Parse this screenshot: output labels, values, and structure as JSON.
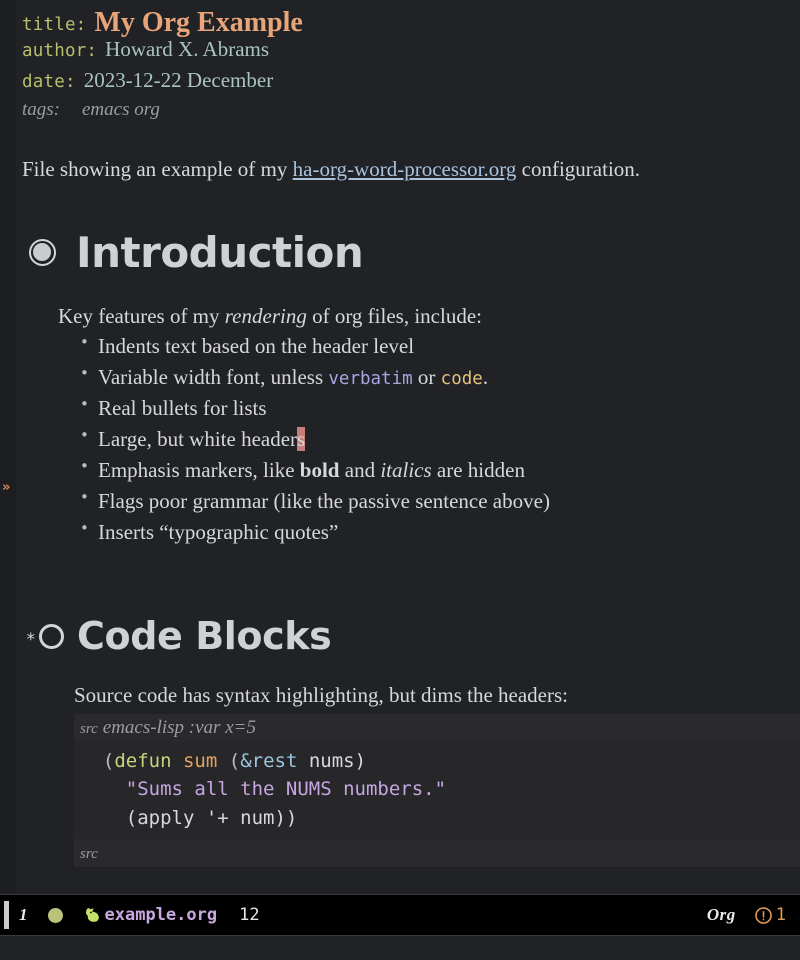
{
  "buffer": {
    "keywords": [
      {
        "key": "title:",
        "value": "My Org Example"
      },
      {
        "key": "author:",
        "value": "Howard X. Abrams"
      },
      {
        "key": "date:",
        "value": "2023-12-22 December"
      }
    ],
    "tags": {
      "key": "tags:",
      "value": "emacs org"
    },
    "intro_paragraph": {
      "before": "File showing an example of my ",
      "link": "ha-org-word-processor.org",
      "after": " configuration."
    },
    "fringe_marker": "»",
    "sections": [
      {
        "bullet_icon": "ring-filled-icon",
        "heading": "Introduction",
        "lead": {
          "before": "Key features of my ",
          "emphasis": "rendering",
          "after": " of org files, include:"
        },
        "list": [
          {
            "parts": [
              {
                "t": "Indents text based on the header level",
                "s": "plain"
              }
            ]
          },
          {
            "parts": [
              {
                "t": "Variable width font, unless ",
                "s": "plain"
              },
              {
                "t": "verbatim",
                "s": "verbatim"
              },
              {
                "t": " or ",
                "s": "plain"
              },
              {
                "t": "code",
                "s": "code"
              },
              {
                "t": ".",
                "s": "plain"
              }
            ]
          },
          {
            "parts": [
              {
                "t": "Real bullets for lists",
                "s": "plain"
              }
            ]
          },
          {
            "parts": [
              {
                "t": "Large, but white header",
                "s": "plain"
              },
              {
                "t": "s",
                "s": "cursor"
              }
            ]
          },
          {
            "parts": [
              {
                "t": "Emphasis markers, like ",
                "s": "plain"
              },
              {
                "t": "bold",
                "s": "bold"
              },
              {
                "t": " and ",
                "s": "plain"
              },
              {
                "t": "italics",
                "s": "italic"
              },
              {
                "t": " are hidden",
                "s": "plain"
              }
            ]
          },
          {
            "parts": [
              {
                "t": "Flags poor grammar (like the passive sentence above)",
                "s": "plain"
              }
            ]
          },
          {
            "parts": [
              {
                "t": "Inserts “typographic quotes”",
                "s": "plain"
              }
            ]
          }
        ]
      },
      {
        "bullet_icon": "ring-hollow-icon",
        "star": "*",
        "heading": "Code Blocks",
        "lead": "Source code has syntax highlighting, but dims the headers:",
        "src_block": {
          "head_tag": "src",
          "head_args": "emacs-lisp :var x=5",
          "foot_tag": "src",
          "lines": [
            [
              {
                "t": "  (",
                "s": "paren"
              },
              {
                "t": "defun",
                "s": "keyword"
              },
              {
                "t": " ",
                "s": "sym"
              },
              {
                "t": "sum",
                "s": "fn"
              },
              {
                "t": " (",
                "s": "paren"
              },
              {
                "t": "&rest",
                "s": "amp"
              },
              {
                "t": " nums)",
                "s": "sym"
              }
            ],
            [
              {
                "t": "    ",
                "s": "sym"
              },
              {
                "t": "\"Sums all the NUMS numbers.\"",
                "s": "str"
              }
            ],
            [
              {
                "t": "    (apply '+ num))",
                "s": "sym"
              }
            ]
          ]
        }
      }
    ]
  },
  "modeline": {
    "window_number": "1",
    "state_dot_color": "#bcc27a",
    "buffer_icon": "unicorn-icon",
    "buffer_name": "example.org",
    "position": "12",
    "major_mode": "Org",
    "warning_icon": "exclamation-circle-icon",
    "warning_count": "1"
  }
}
